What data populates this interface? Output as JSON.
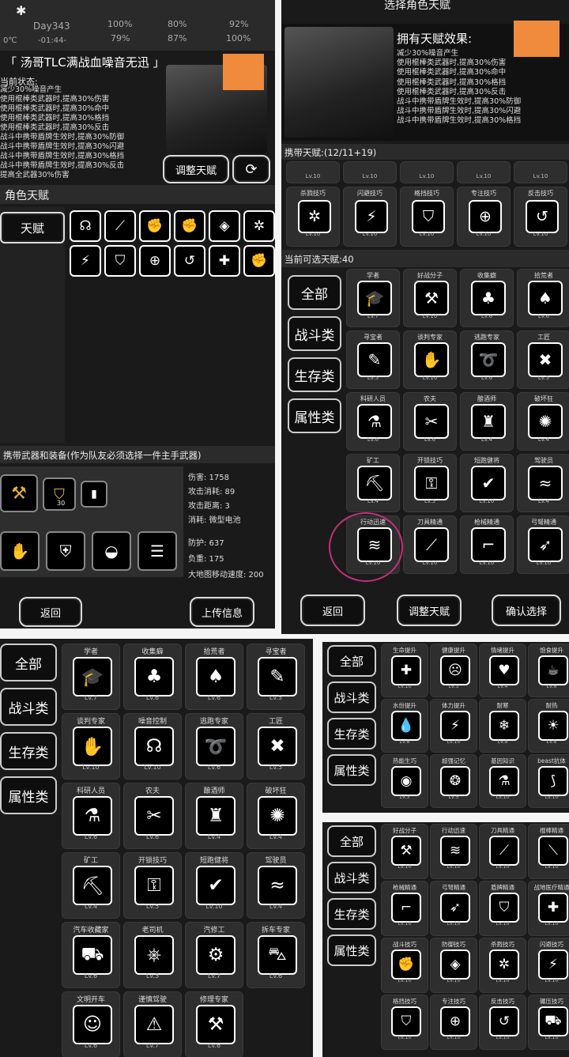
{
  "panel1": {
    "status": {
      "day": "Day343",
      "time": "-01:44-",
      "temp": "0℃",
      "p1": "100%",
      "p2": "79%",
      "p3": "80%",
      "p4": "87%",
      "p5": "92%",
      "p6": "100%"
    },
    "char_name": "「 汤哥TLC满战血噪音无迅 」",
    "state_label": "当前状态:",
    "state_lines": [
      "减少30%噪音产生",
      "使用棍棒类武器时,提高30%伤害",
      "使用棍棒类武器时,提高30%命中",
      "使用棍棒类武器时,提高30%格挡",
      "使用棍棒类武器时,提高30%反击",
      "战斗中携带盾牌生效时,提高30%防御",
      "战斗中携带盾牌生效时,提高30%闪避",
      "战斗中携带盾牌生效时,提高30%格挡",
      "战斗中携带盾牌生效时,提高30%反击",
      "提高全武器30%伤害"
    ],
    "adjust_btn": "调整天赋",
    "section_title": "角色天赋",
    "tab_label": "天赋",
    "weapons_title": "携带武器和装备(作为队友必须选择一件主手武器)",
    "ammo": "30",
    "stats": [
      "伤害: 1758",
      "攻击消耗: 89",
      "攻击距离: 3",
      "消耗: 微型电池"
    ],
    "armor_stats": [
      "防护: 637",
      "负重: 175",
      "大地图移动速度: 200"
    ],
    "back_btn": "返回",
    "upload_btn": "上传信息"
  },
  "panel2": {
    "header": "选择角色天赋",
    "effects_title": "拥有天赋效果:",
    "effect_lines": [
      "减少30%噪音产生",
      "使用棍棒类武器时,提高30%伤害",
      "使用棍棒类武器时,提高30%命中",
      "使用棍棒类武器时,提高30%格挡",
      "使用棍棒类武器时,提高30%反击",
      "战斗中携带盾牌生效时,提高30%防御",
      "战斗中携带盾牌生效时,提高30%闪避",
      "战斗中携带盾牌生效时,提高30%格挡"
    ],
    "carry_title": "携带天赋:(12/11+19)",
    "top_lv": [
      "Lv.10",
      "Lv.10",
      "Lv.10",
      "Lv.10",
      "Lv.10"
    ],
    "carry_row": [
      {
        "name": "杀戮技巧",
        "lv": "Lv.10",
        "icon": "✲"
      },
      {
        "name": "闪避技巧",
        "lv": "Lv.10",
        "icon": "⚡"
      },
      {
        "name": "格挡技巧",
        "lv": "Lv.10",
        "icon": "⛉"
      },
      {
        "name": "专注技巧",
        "lv": "Lv.10",
        "icon": "⊕"
      },
      {
        "name": "反击技巧",
        "lv": "Lv.10",
        "icon": "↺"
      }
    ],
    "avail_title": "当前可选天赋:40",
    "cats": [
      "全部",
      "战斗类",
      "生存类",
      "属性类"
    ],
    "grid": [
      {
        "name": "学者",
        "lv": "Lv.7",
        "icon": "🎓"
      },
      {
        "name": "好战分子",
        "lv": "Lv.10",
        "icon": "⚒"
      },
      {
        "name": "收集癖",
        "lv": "Lv.6",
        "icon": "♣"
      },
      {
        "name": "拾荒者",
        "lv": "Lv.6",
        "icon": "♠"
      },
      {
        "name": "寻宝者",
        "lv": "Lv.5",
        "icon": "✎"
      },
      {
        "name": "谈判专家",
        "lv": "Lv.10",
        "icon": "✋"
      },
      {
        "name": "逃跑专家",
        "lv": "Lv.6",
        "icon": "➰"
      },
      {
        "name": "工匠",
        "lv": "Lv.5",
        "icon": "✖"
      },
      {
        "name": "科研人员",
        "lv": "Lv.6",
        "icon": "⚗"
      },
      {
        "name": "农夫",
        "lv": "Lv.6",
        "icon": "✂"
      },
      {
        "name": "酿酒师",
        "lv": "Lv.4",
        "icon": "♜"
      },
      {
        "name": "破坏狂",
        "lv": "Lv.4",
        "icon": "✺"
      },
      {
        "name": "矿工",
        "lv": "Lv.4",
        "icon": "⛏"
      },
      {
        "name": "开锁技巧",
        "lv": "Lv.5",
        "icon": "⚿"
      },
      {
        "name": "短跑健将",
        "lv": "Lv.10",
        "icon": "✔"
      },
      {
        "name": "驾驶员",
        "lv": "Lv.4",
        "icon": "≈"
      },
      {
        "name": "行动迅速",
        "lv": "Lv.10",
        "icon": "≋"
      },
      {
        "name": "刀具精通",
        "lv": "Lv.10",
        "icon": "⟋"
      },
      {
        "name": "枪械精通",
        "lv": "Lv.10",
        "icon": "⌐"
      },
      {
        "name": "弓弩精通",
        "lv": "Lv.10",
        "icon": "➶"
      }
    ],
    "back_btn": "返回",
    "adjust_btn": "调整天赋",
    "confirm_btn": "确认选择"
  },
  "panel3": {
    "cats": [
      "全部",
      "战斗类",
      "生存类",
      "属性类"
    ],
    "grid": [
      {
        "name": "学者",
        "lv": "Lv.7",
        "icon": "🎓"
      },
      {
        "name": "收集癖",
        "lv": "Lv.6",
        "icon": "♣"
      },
      {
        "name": "拾荒者",
        "lv": "Lv.6",
        "icon": "♠"
      },
      {
        "name": "寻宝者",
        "lv": "Lv.5",
        "icon": "✎"
      },
      {
        "name": "谈判专家",
        "lv": "Lv.10",
        "icon": "✋"
      },
      {
        "name": "噪音控制",
        "lv": "Lv.10",
        "icon": "☊"
      },
      {
        "name": "逃跑专家",
        "lv": "Lv.6",
        "icon": "➰"
      },
      {
        "name": "工匠",
        "lv": "Lv.5",
        "icon": "✖"
      },
      {
        "name": "科研人员",
        "lv": "Lv.6",
        "icon": "⚗"
      },
      {
        "name": "农夫",
        "lv": "Lv.6",
        "icon": "✂"
      },
      {
        "name": "酿酒师",
        "lv": "Lv.4",
        "icon": "♜"
      },
      {
        "name": "破坏狂",
        "lv": "Lv.4",
        "icon": "✺"
      },
      {
        "name": "矿工",
        "lv": "Lv.4",
        "icon": "⛏"
      },
      {
        "name": "开锁技巧",
        "lv": "Lv.5",
        "icon": "⚿"
      },
      {
        "name": "短跑健将",
        "lv": "Lv.10",
        "icon": "✔"
      },
      {
        "name": "驾驶员",
        "lv": "Lv.4",
        "icon": "≈"
      },
      {
        "name": "汽车收藏家",
        "lv": "Lv.6",
        "icon": "⛟"
      },
      {
        "name": "老司机",
        "lv": "Lv.3",
        "icon": "⎈"
      },
      {
        "name": "汽修工",
        "lv": "Lv.7",
        "icon": "⚙"
      },
      {
        "name": "拆车专家",
        "lv": "Lv.6",
        "icon": "⛍"
      },
      {
        "name": "文明开车",
        "lv": "Lv.6",
        "icon": "☺"
      },
      {
        "name": "谨慎驾驶",
        "lv": "Lv.7",
        "icon": "⚠"
      },
      {
        "name": "修理专家",
        "lv": "Lv.6",
        "icon": "⚒"
      }
    ]
  },
  "panel4": {
    "cats": [
      "全部",
      "战斗类",
      "生存类",
      "属性类"
    ],
    "grid": [
      {
        "name": "生命提升",
        "lv": "Lv.10",
        "icon": "✚"
      },
      {
        "name": "健康提升",
        "lv": "Lv.3",
        "icon": "☹"
      },
      {
        "name": "情绪提升",
        "lv": "Lv.4",
        "icon": "♥"
      },
      {
        "name": "饱食提升",
        "lv": "Lv.6",
        "icon": "☕"
      },
      {
        "name": "水份提升",
        "lv": "Lv.8",
        "icon": "💧"
      },
      {
        "name": "体力提升",
        "lv": "Lv.10",
        "icon": "⚡"
      },
      {
        "name": "耐寒",
        "lv": "Lv.8",
        "icon": "❄"
      },
      {
        "name": "耐热",
        "lv": "Lv.8",
        "icon": "☀"
      },
      {
        "name": "热能生巧",
        "lv": "Lv.3",
        "icon": "◉"
      },
      {
        "name": "超强记忆",
        "lv": "Lv.5",
        "icon": "❂"
      },
      {
        "name": "基因知识",
        "lv": "Lv.10",
        "icon": "⚗"
      },
      {
        "name": "beast抗体",
        "lv": "Lv.10",
        "icon": "⟆"
      }
    ]
  },
  "panel5": {
    "cats": [
      "全部",
      "战斗类",
      "生存类",
      "属性类"
    ],
    "grid": [
      {
        "name": "好战分子",
        "lv": "Lv.10",
        "icon": "⚒"
      },
      {
        "name": "行动迅速",
        "lv": "Lv.10",
        "icon": "≋"
      },
      {
        "name": "刀具精通",
        "lv": "Lv.10",
        "icon": "⟋"
      },
      {
        "name": "棍棒精通",
        "lv": "Lv.10",
        "icon": "⟍"
      },
      {
        "name": "枪械精通",
        "lv": "Lv.10",
        "icon": "⌐"
      },
      {
        "name": "弓弩精通",
        "lv": "Lv.10",
        "icon": "➶"
      },
      {
        "name": "盾牌精通",
        "lv": "Lv.10",
        "icon": "⛉"
      },
      {
        "name": "战地医疗精通",
        "lv": "Lv.10",
        "icon": "✚"
      },
      {
        "name": "战斗技巧",
        "lv": "Lv.10",
        "icon": "✊"
      },
      {
        "name": "防御技巧",
        "lv": "Lv.10",
        "icon": "◈"
      },
      {
        "name": "杀戮技巧",
        "lv": "Lv.10",
        "icon": "✲"
      },
      {
        "name": "闪避技巧",
        "lv": "Lv.10",
        "icon": "⚡"
      },
      {
        "name": "格挡技巧",
        "lv": "Lv.10",
        "icon": "⛉"
      },
      {
        "name": "专注技巧",
        "lv": "Lv.10",
        "icon": "⊕"
      },
      {
        "name": "反击技巧",
        "lv": "Lv.10",
        "icon": "↺"
      },
      {
        "name": "碾压技巧",
        "lv": "Lv.10",
        "icon": "⛟"
      }
    ]
  }
}
